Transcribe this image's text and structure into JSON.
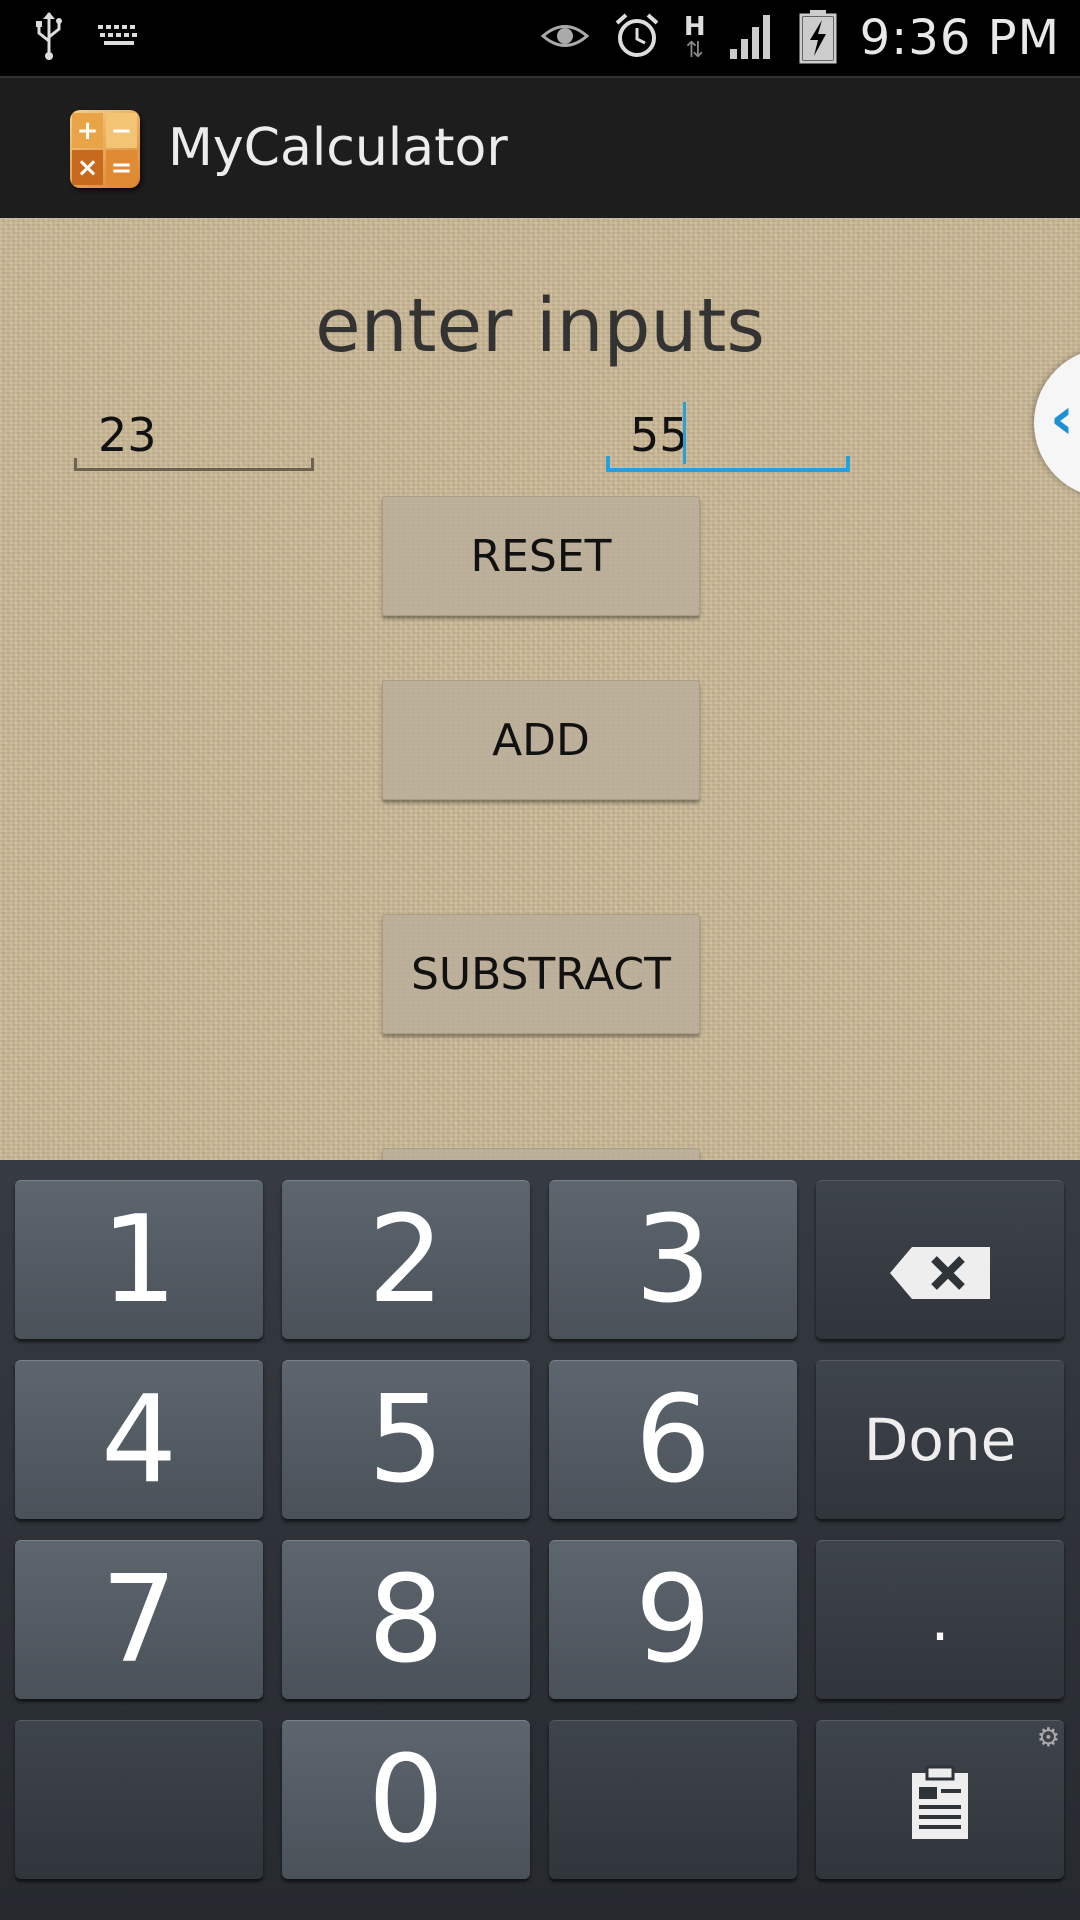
{
  "status_bar": {
    "time": "9:36 PM",
    "icons": [
      "usb-icon",
      "keyboard-icon",
      "eye-icon",
      "alarm-icon",
      "network-h-icon",
      "signal-icon",
      "battery-charging-icon"
    ],
    "network_label": "H"
  },
  "action_bar": {
    "title": "MyCalculator",
    "icon_glyphs": [
      "+",
      "−",
      "×",
      "="
    ]
  },
  "main": {
    "heading": "enter inputs",
    "input1_value": "23",
    "input2_value": "55",
    "buttons": {
      "reset": "RESET",
      "add": "ADD",
      "subtract": "SUBSTRACT"
    }
  },
  "side_handle": {
    "glyph": "‹"
  },
  "keyboard": {
    "keys": [
      "1",
      "2",
      "3",
      "4",
      "5",
      "6",
      "7",
      "8",
      "9",
      "0"
    ],
    "done_label": "Done",
    "dot_label": "."
  },
  "colors": {
    "accent": "#2a9ed8",
    "content_bg": "#cbb996",
    "actionbar_bg": "#1d1d1d"
  }
}
